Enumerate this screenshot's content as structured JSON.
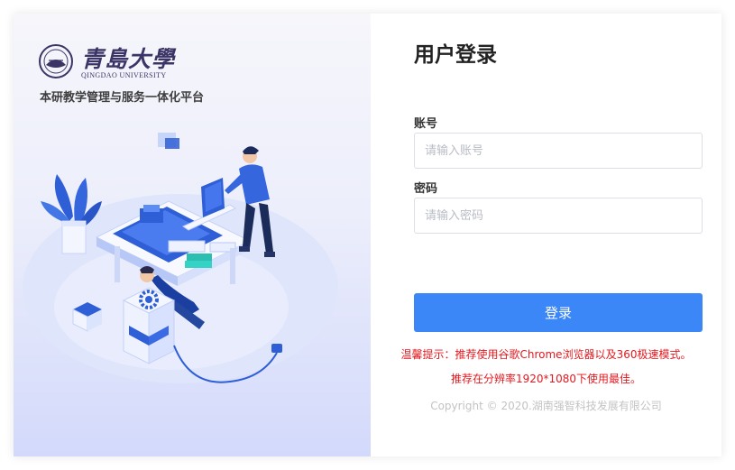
{
  "branding": {
    "university_name_cn": "青島大學",
    "university_name_en": "QINGDAO UNIVERSITY",
    "platform_name": "本研教学管理与服务一体化平台"
  },
  "login": {
    "title": "用户登录",
    "account_label": "账号",
    "account_placeholder": "请输入账号",
    "account_value": "",
    "password_label": "密码",
    "password_placeholder": "请输入密码",
    "password_value": "",
    "submit_label": "登录"
  },
  "notices": {
    "browser_tip": "温馨提示：推荐使用谷歌Chrome浏览器以及360极速模式。",
    "resolution_tip": "推荐在分辨率1920*1080下使用最佳。",
    "copyright": "Copyright © 2020.湖南强智科技发展有限公司"
  },
  "colors": {
    "primary_button": "#3c87f8",
    "notice_red": "#e4181f",
    "logo_purple": "#3a3566",
    "illustration_blue": "#2f5fd6"
  },
  "icons": [
    "university-seal-icon",
    "gear-icon"
  ]
}
